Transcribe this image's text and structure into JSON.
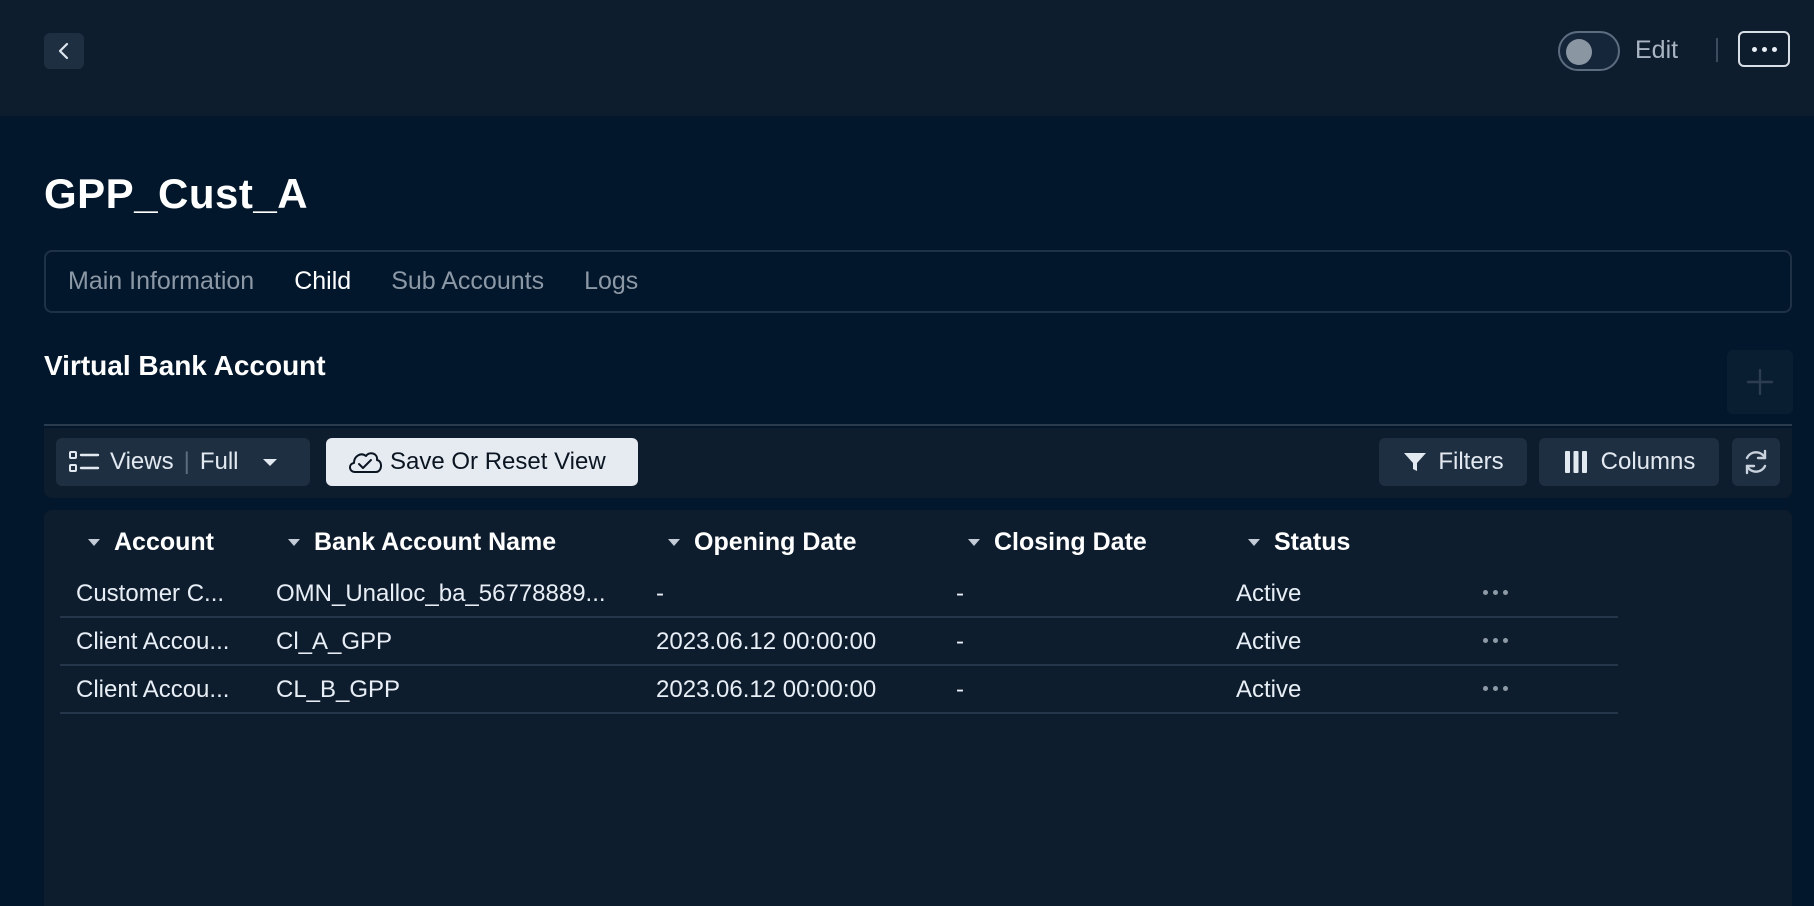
{
  "header": {
    "edit_label": "Edit",
    "edit_toggle_on": false
  },
  "page": {
    "title": "GPP_Cust_A"
  },
  "tabs": [
    {
      "label": "Main Information",
      "active": false
    },
    {
      "label": "Child",
      "active": true
    },
    {
      "label": "Sub Accounts",
      "active": false
    },
    {
      "label": "Logs",
      "active": false
    }
  ],
  "section": {
    "title": "Virtual Bank Account"
  },
  "toolbar": {
    "views_label": "Views",
    "views_value": "Full",
    "save_reset_label": "Save Or Reset View",
    "filters_label": "Filters",
    "columns_label": "Columns"
  },
  "table": {
    "columns": [
      "Account",
      "Bank Account Name",
      "Opening Date",
      "Closing Date",
      "Status"
    ],
    "rows": [
      [
        "Customer C...",
        "OMN_Unalloc_ba_56778889...",
        "-",
        "-",
        "Active"
      ],
      [
        "Client Accou...",
        "Cl_A_GPP",
        "2023.06.12 00:00:00",
        "-",
        "Active"
      ],
      [
        "Client Accou...",
        "CL_B_GPP",
        "2023.06.12 00:00:00",
        "-",
        "Active"
      ]
    ]
  },
  "colors": {
    "background": "#02172b",
    "panel": "#0e1d2e",
    "button": "#1f2f42",
    "primary_button": "#e6ebf2",
    "text": "#e8eef5",
    "muted_text": "#8c98a6"
  },
  "icons": {
    "back": "chevron-left-icon",
    "more": "ellipsis-icon",
    "add": "plus-icon",
    "views": "list-icon",
    "views_dropdown": "caret-down-icon",
    "save": "cloud-check-icon",
    "filters": "funnel-icon",
    "columns": "columns-icon",
    "refresh": "refresh-icon",
    "sort": "caret-down-icon",
    "row_menu": "ellipsis-icon"
  }
}
